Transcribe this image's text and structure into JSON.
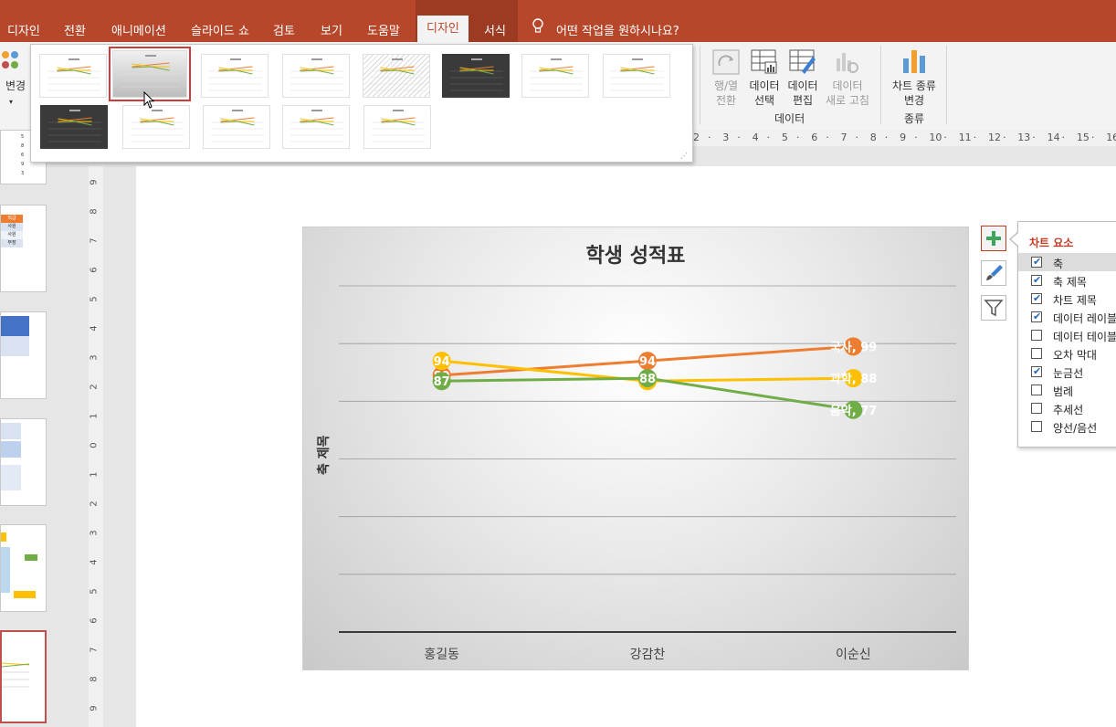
{
  "tabs": [
    "디자인",
    "전환",
    "애니메이션",
    "슬라이드 쇼",
    "검토",
    "보기",
    "도움말"
  ],
  "context_tabs": {
    "active": "디자인",
    "other": "서식"
  },
  "tell_me": "어떤 작업을 원하시나요?",
  "ribbon": {
    "change_colors": "변경",
    "switch_row_col": [
      "행/열",
      "전환"
    ],
    "select_data": [
      "데이터",
      "선택"
    ],
    "edit_data": [
      "데이터",
      "편집"
    ],
    "refresh_data": [
      "데이터",
      "새로 고침"
    ],
    "group_data": "데이터",
    "change_chart_type": [
      "차트 종류",
      "변경"
    ],
    "group_type": "종류"
  },
  "icons": {
    "lightbulb": "lightbulb-icon",
    "switch": "switch-row-column-icon",
    "select": "select-data-icon",
    "edit": "edit-data-icon",
    "refresh": "refresh-data-icon",
    "charttype": "change-chart-type-icon",
    "plus": "plus-icon",
    "brush": "brush-icon",
    "filter": "filter-icon"
  },
  "ruler": {
    "h": [
      "2",
      "3",
      "4",
      "5",
      "6",
      "7",
      "8",
      "9",
      "10",
      "11",
      "12",
      "13",
      "14",
      "15",
      "16"
    ],
    "v": [
      "9",
      "8",
      "7",
      "6",
      "5",
      "4",
      "3",
      "2",
      "1",
      "0",
      "1",
      "2",
      "3",
      "4",
      "5",
      "6",
      "7",
      "8",
      "9"
    ]
  },
  "slide_panel": {
    "table_fragment": [
      "직급",
      "사원",
      "사원",
      "부장"
    ],
    "numbers_fragment": [
      "5",
      "8",
      "6",
      "9",
      "3"
    ]
  },
  "chart_elements": {
    "title": "차트 요소",
    "items": [
      {
        "label": "축",
        "checked": true
      },
      {
        "label": "축 제목",
        "checked": true
      },
      {
        "label": "차트 제목",
        "checked": true
      },
      {
        "label": "데이터 레이블",
        "checked": true
      },
      {
        "label": "데이터 테이블",
        "checked": false
      },
      {
        "label": "오차 막대",
        "checked": false
      },
      {
        "label": "눈금선",
        "checked": true
      },
      {
        "label": "범례",
        "checked": false
      },
      {
        "label": "추세선",
        "checked": false
      },
      {
        "label": "양선/음선",
        "checked": false
      }
    ]
  },
  "chart_data": {
    "type": "line",
    "title": "학생 성적표",
    "ylabel": "축 제목",
    "xlabel": "",
    "categories": [
      "홍길동",
      "강감찬",
      "이순신"
    ],
    "series": [
      {
        "name": "국사",
        "values": [
          89,
          94,
          99
        ],
        "color": "#ed7d31"
      },
      {
        "name": "과학",
        "values": [
          94,
          87,
          88
        ],
        "color": "#ffc000"
      },
      {
        "name": "음악",
        "values": [
          87,
          88,
          77
        ],
        "color": "#70ad47"
      }
    ],
    "ylim": [
      0,
      120
    ],
    "grid": true,
    "legend": "none",
    "end_labels": [
      "국사, 99",
      "과학, 88",
      "음악, 77"
    ]
  }
}
